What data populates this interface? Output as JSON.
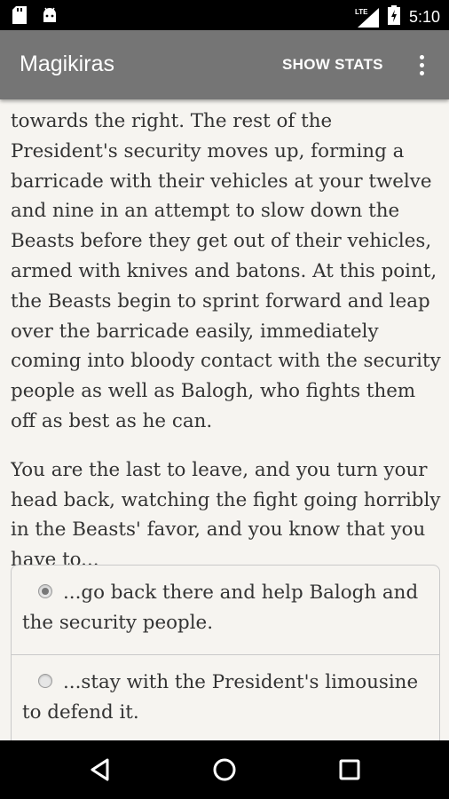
{
  "status_bar": {
    "time": "5:10",
    "network_label": "LTE",
    "icons": [
      "sd-card-icon",
      "android-icon",
      "signal-icon",
      "battery-icon"
    ]
  },
  "app_bar": {
    "title": "Magikiras",
    "show_stats_label": "SHOW STATS",
    "overflow_icon": "more-vert-icon"
  },
  "story": {
    "paragraphs": [
      "towards the right. The rest of the President's security moves up, forming a barricade with their vehicles at your twelve and nine in an attempt to slow down the Beasts before they get out of their vehicles, armed with knives and batons. At this point, the Beasts begin to sprint forward and leap over the barricade easily, immediately coming into bloody contact with the security people as well as Balogh, who fights them off as best as he can.",
      "You are the last to leave, and you turn your head back, watching the fight going horribly in the Beasts' favor, and you know that you have to..."
    ]
  },
  "choices": [
    {
      "label": "...go back there and help Balogh and the security people.",
      "selected": true
    },
    {
      "label": "...stay with the President's limousine to defend it.",
      "selected": false
    }
  ],
  "nav_bar": {
    "icons": [
      "back-icon",
      "home-icon",
      "recents-icon"
    ]
  },
  "colors": {
    "app_bar": "#757575",
    "background": "#f6f4f0",
    "text": "#333333"
  }
}
